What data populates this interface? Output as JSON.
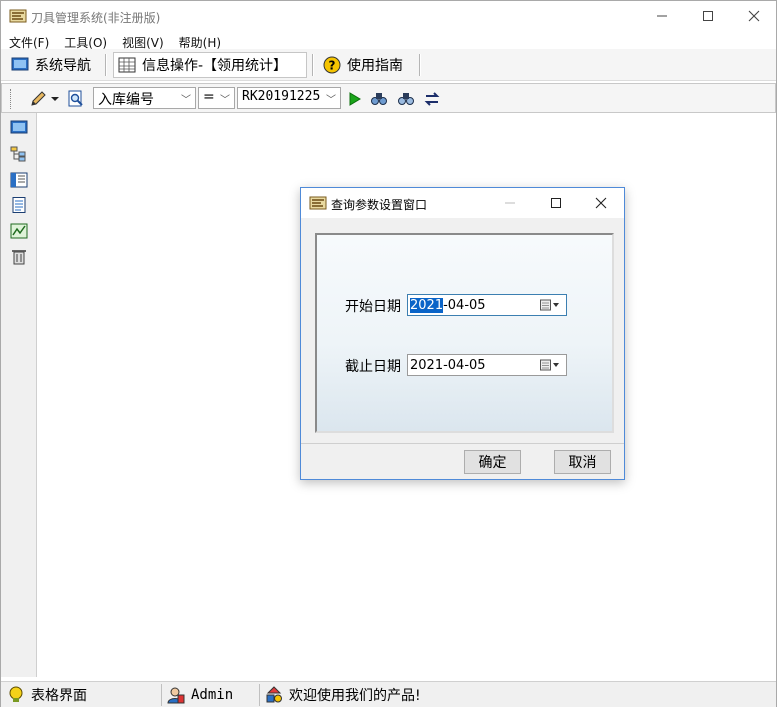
{
  "window": {
    "title": "刀具管理系统(非注册版)"
  },
  "menu": [
    "文件(F)",
    "工具(O)",
    "视图(V)",
    "帮助(H)"
  ],
  "toolbar": {
    "nav_label": "系统导航",
    "info_label": "信息操作-【领用统计】",
    "guide_label": "使用指南"
  },
  "filter": {
    "field": "入库编号",
    "operator": "=",
    "value": "RK20191225"
  },
  "dialog": {
    "title": "查询参数设置窗口",
    "start_label": "开始日期",
    "start_value_selected": "2021",
    "start_value_rest": "-04-05",
    "end_label": "截止日期",
    "end_value": "2021-04-05",
    "ok_label": "确定",
    "cancel_label": "取消"
  },
  "status": {
    "view_label": "表格界面",
    "user": "Admin",
    "welcome": "欢迎使用我们的产品!"
  },
  "colors": {
    "dialog_border": "#4f8ad8",
    "selection": "#0a64c8",
    "run_icon": "#1aa51a"
  }
}
